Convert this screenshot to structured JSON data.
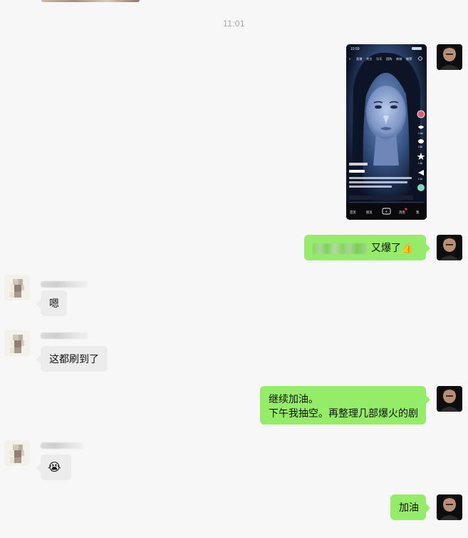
{
  "timestamp": "11:01",
  "messages": [
    {
      "id": "m1",
      "sender": "me",
      "type": "image",
      "description_icon": "phone-screenshot-video-feed"
    },
    {
      "id": "m2",
      "sender": "me",
      "type": "text",
      "redacted_prefix": true,
      "text": "又爆了👍"
    },
    {
      "id": "m3",
      "sender": "other",
      "type": "text",
      "text": "嗯"
    },
    {
      "id": "m4",
      "sender": "other",
      "type": "text",
      "text": "这都刷到了"
    },
    {
      "id": "m5",
      "sender": "me",
      "type": "text",
      "lines": [
        "继续加油。",
        "下午我抽空。再整理几部爆火的剧"
      ]
    },
    {
      "id": "m6",
      "sender": "other",
      "type": "emoji",
      "text": "😭"
    },
    {
      "id": "m7",
      "sender": "me",
      "type": "text",
      "text": "加油"
    }
  ],
  "screenshot": {
    "status_time": "10:59",
    "tabs": [
      "直播",
      "关注",
      "乐乐",
      "团购",
      "商城",
      "推荐"
    ],
    "bottom_nav": [
      "首页",
      "朋友",
      "+",
      "消息",
      "我"
    ],
    "counts": [
      "2.3w",
      "2.8k",
      "1.5k",
      "1.1k"
    ]
  },
  "colors": {
    "background": "#f7f7f7",
    "my_bubble": "#95ec69",
    "other_bubble": "#ececec",
    "timestamp": "#a3a3a3"
  }
}
